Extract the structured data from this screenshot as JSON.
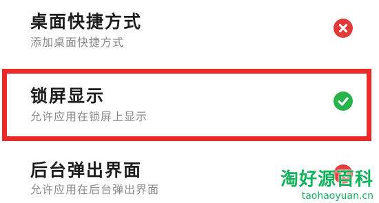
{
  "permissions": [
    {
      "title": "桌面快捷方式",
      "subtitle": "添加桌面快捷方式",
      "status": "denied",
      "icon": "close-icon"
    },
    {
      "title": "锁屏显示",
      "subtitle": "允许应用在锁屏上显示",
      "status": "allowed",
      "icon": "check-icon"
    },
    {
      "title": "后台弹出界面",
      "subtitle": "允许应用在后台弹出界面",
      "status": "denied",
      "icon": "close-icon"
    }
  ],
  "colors": {
    "highlight": "#ec2a2a",
    "denied": "#e23a37",
    "allowed": "#27b34a",
    "watermark": "#12b15c"
  },
  "watermark": {
    "title": "淘好源百科",
    "url": "taohaoyuan.cn"
  }
}
